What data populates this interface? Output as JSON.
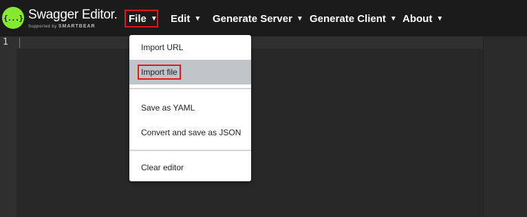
{
  "logo": {
    "title": "Swagger Editor.",
    "subtitle_prefix": "Supported by",
    "subtitle_brand": "SMARTBEAR",
    "icon_text": "{...}"
  },
  "menu": {
    "file": "File",
    "edit": "Edit",
    "generate_server": "Generate Server",
    "generate_client": "Generate Client",
    "about": "About",
    "caret": "▼"
  },
  "editor": {
    "line_number": "1"
  },
  "file_menu": {
    "import_url": "Import URL",
    "import_file": "Import file",
    "save_yaml": "Save as YAML",
    "convert_json": "Convert and save as JSON",
    "clear_editor": "Clear editor"
  },
  "colors": {
    "highlight": "#e8141c",
    "logo_green": "#85ea2d",
    "selected_item": "#c0c4c9"
  }
}
